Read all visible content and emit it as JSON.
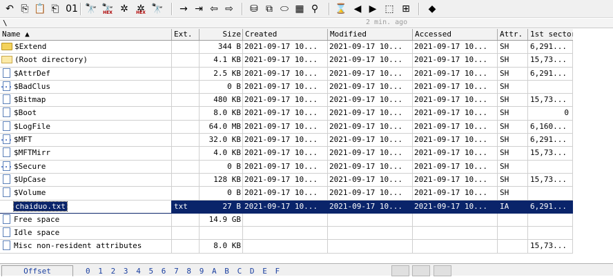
{
  "toolbar": {
    "buttons": [
      {
        "name": "undo-icon",
        "glyph": "↶"
      },
      {
        "name": "copy-icon",
        "glyph": "⎘"
      },
      {
        "name": "paste-icon",
        "glyph": "📋"
      },
      {
        "name": "clipboard-icon",
        "glyph": "⎗"
      },
      {
        "name": "binary-icon",
        "glyph": "01"
      },
      {
        "name": "find-icon",
        "glyph": "🔭"
      },
      {
        "name": "find-hex-icon",
        "glyph": "🔭",
        "hex": "HEX"
      },
      {
        "name": "replace-icon",
        "glyph": "✲"
      },
      {
        "name": "replace-hex-icon",
        "glyph": "✲",
        "hex": "HEX"
      },
      {
        "name": "find-next-icon",
        "glyph": "🔭"
      },
      {
        "name": "goto-offset-icon",
        "glyph": "→"
      },
      {
        "name": "goto-sector-icon",
        "glyph": "⇥"
      },
      {
        "name": "back-icon",
        "glyph": "⇦"
      },
      {
        "name": "forward-icon",
        "glyph": "⇨"
      },
      {
        "name": "disk-icon",
        "glyph": "⛁"
      },
      {
        "name": "disk-clone-icon",
        "glyph": "⧉"
      },
      {
        "name": "ram-icon",
        "glyph": "⬭"
      },
      {
        "name": "calculator-icon",
        "glyph": "▦"
      },
      {
        "name": "search-icon",
        "glyph": "⚲"
      },
      {
        "name": "hourglass-icon",
        "glyph": "⌛"
      },
      {
        "name": "prev-icon",
        "glyph": "◀"
      },
      {
        "name": "next-icon",
        "glyph": "▶"
      },
      {
        "name": "snapshot-icon",
        "glyph": "⬚"
      },
      {
        "name": "grid-icon",
        "glyph": "⊞"
      },
      {
        "name": "tag-icon",
        "glyph": "◆"
      }
    ]
  },
  "path": {
    "text": "\\",
    "status": "2 min. ago"
  },
  "columns": [
    "Name ▲",
    "Ext.",
    "Size",
    "Created",
    "Modified",
    "Accessed",
    "Attr.",
    "1st sector"
  ],
  "rows": [
    {
      "icon": "folder",
      "name": "$Extend",
      "ext": "",
      "size": "344 B",
      "created": "2021-09-17  10...",
      "modified": "2021-09-17  10...",
      "accessed": "2021-09-17  10...",
      "attr": "SH",
      "sector": "6,291...",
      "sector_align": "left"
    },
    {
      "icon": "folder-open",
      "name": "(Root directory)",
      "ext": "",
      "size": "4.1 KB",
      "created": "2021-09-17  10...",
      "modified": "2021-09-17  10...",
      "accessed": "2021-09-17  10...",
      "attr": "SH",
      "sector": "15,73...",
      "sector_align": "left"
    },
    {
      "icon": "file",
      "name": "$AttrDef",
      "ext": "",
      "size": "2.5 KB",
      "created": "2021-09-17  10...",
      "modified": "2021-09-17  10...",
      "accessed": "2021-09-17  10...",
      "attr": "SH",
      "sector": "6,291...",
      "sector_align": "left"
    },
    {
      "icon": "file-dots",
      "name": "$BadClus",
      "ext": "",
      "size": "0 B",
      "created": "2021-09-17  10...",
      "modified": "2021-09-17  10...",
      "accessed": "2021-09-17  10...",
      "attr": "SH",
      "sector": "",
      "sector_align": "left"
    },
    {
      "icon": "file",
      "name": "$Bitmap",
      "ext": "",
      "size": "480 KB",
      "created": "2021-09-17  10...",
      "modified": "2021-09-17  10...",
      "accessed": "2021-09-17  10...",
      "attr": "SH",
      "sector": "15,73...",
      "sector_align": "left"
    },
    {
      "icon": "file",
      "name": "$Boot",
      "ext": "",
      "size": "8.0 KB",
      "created": "2021-09-17  10...",
      "modified": "2021-09-17  10...",
      "accessed": "2021-09-17  10...",
      "attr": "SH",
      "sector": "0",
      "sector_align": "right"
    },
    {
      "icon": "file",
      "name": "$LogFile",
      "ext": "",
      "size": "64.0 MB",
      "created": "2021-09-17  10...",
      "modified": "2021-09-17  10...",
      "accessed": "2021-09-17  10...",
      "attr": "SH",
      "sector": "6,160...",
      "sector_align": "left"
    },
    {
      "icon": "file-dots",
      "name": "$MFT",
      "ext": "",
      "size": "32.0 KB",
      "created": "2021-09-17  10...",
      "modified": "2021-09-17  10...",
      "accessed": "2021-09-17  10...",
      "attr": "SH",
      "sector": "6,291...",
      "sector_align": "left"
    },
    {
      "icon": "file",
      "name": "$MFTMirr",
      "ext": "",
      "size": "4.0 KB",
      "created": "2021-09-17  10...",
      "modified": "2021-09-17  10...",
      "accessed": "2021-09-17  10...",
      "attr": "SH",
      "sector": "15,73...",
      "sector_align": "left"
    },
    {
      "icon": "file-dots",
      "name": "$Secure",
      "ext": "",
      "size": "0 B",
      "created": "2021-09-17  10...",
      "modified": "2021-09-17  10...",
      "accessed": "2021-09-17  10...",
      "attr": "SH",
      "sector": "",
      "sector_align": "left"
    },
    {
      "icon": "file",
      "name": "$UpCase",
      "ext": "",
      "size": "128 KB",
      "created": "2021-09-17  10...",
      "modified": "2021-09-17  10...",
      "accessed": "2021-09-17  10...",
      "attr": "SH",
      "sector": "15,73...",
      "sector_align": "left"
    },
    {
      "icon": "file",
      "name": "$Volume",
      "ext": "",
      "size": "0 B",
      "created": "2021-09-17  10...",
      "modified": "2021-09-17  10...",
      "accessed": "2021-09-17  10...",
      "attr": "SH",
      "sector": "",
      "sector_align": "left"
    },
    {
      "icon": "blank",
      "name": "chaiduo.txt",
      "ext": "txt",
      "size": "27 B",
      "created": "2021-09-17  10...",
      "modified": "2021-09-17  10...",
      "accessed": "2021-09-17  10...",
      "attr": "IA",
      "sector": "6,291...",
      "sector_align": "left",
      "selected": true
    },
    {
      "icon": "file",
      "name": "Free space",
      "ext": "",
      "size": "14.9 GB",
      "created": "",
      "modified": "",
      "accessed": "",
      "attr": "",
      "sector": "",
      "sector_align": "left"
    },
    {
      "icon": "file",
      "name": "Idle space",
      "ext": "",
      "size": "",
      "created": "",
      "modified": "",
      "accessed": "",
      "attr": "",
      "sector": "",
      "sector_align": "left"
    },
    {
      "icon": "file",
      "name": "Misc non-resident attributes",
      "ext": "",
      "size": "8.0 KB",
      "created": "",
      "modified": "",
      "accessed": "",
      "attr": "",
      "sector": "15,73...",
      "sector_align": "left"
    }
  ],
  "hexruler": {
    "offset_label": "Offset",
    "columns": [
      "0",
      "1",
      "2",
      "3",
      "4",
      "5",
      "6",
      "7",
      "8",
      "9",
      "A",
      "B",
      "C",
      "D",
      "E",
      "F"
    ]
  }
}
